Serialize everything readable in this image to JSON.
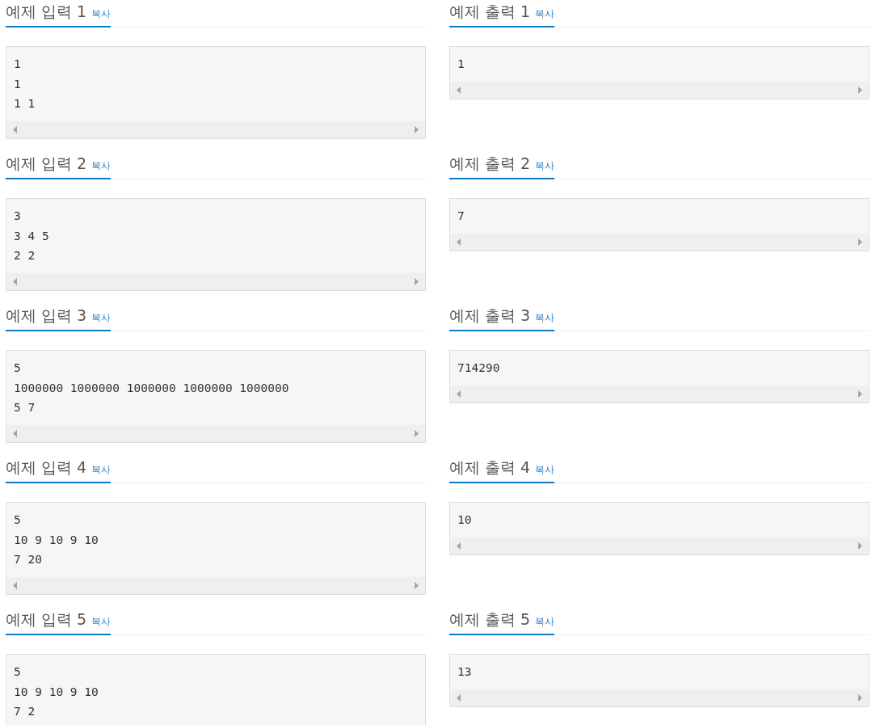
{
  "samples": [
    {
      "input": {
        "title": "예제 입력 1",
        "copy": "복사",
        "lines": [
          "1",
          "1",
          "1 1"
        ]
      },
      "output": {
        "title": "예제 출력 1",
        "copy": "복사",
        "lines": [
          "1"
        ]
      }
    },
    {
      "input": {
        "title": "예제 입력 2",
        "copy": "복사",
        "lines": [
          "3",
          "3 4 5",
          "2 2"
        ]
      },
      "output": {
        "title": "예제 출력 2",
        "copy": "복사",
        "lines": [
          "7"
        ]
      }
    },
    {
      "input": {
        "title": "예제 입력 3",
        "copy": "복사",
        "lines": [
          "5",
          "1000000 1000000 1000000 1000000 1000000",
          "5 7"
        ]
      },
      "output": {
        "title": "예제 출력 3",
        "copy": "복사",
        "lines": [
          "714290"
        ]
      }
    },
    {
      "input": {
        "title": "예제 입력 4",
        "copy": "복사",
        "lines": [
          "5",
          "10 9 10 9 10",
          "7 20"
        ]
      },
      "output": {
        "title": "예제 출력 4",
        "copy": "복사",
        "lines": [
          "10"
        ]
      }
    },
    {
      "input": {
        "title": "예제 입력 5",
        "copy": "복사",
        "lines": [
          "5",
          "10 9 10 9 10",
          "7 2"
        ]
      },
      "output": {
        "title": "예제 출력 5",
        "copy": "복사",
        "lines": [
          "13"
        ]
      }
    }
  ]
}
